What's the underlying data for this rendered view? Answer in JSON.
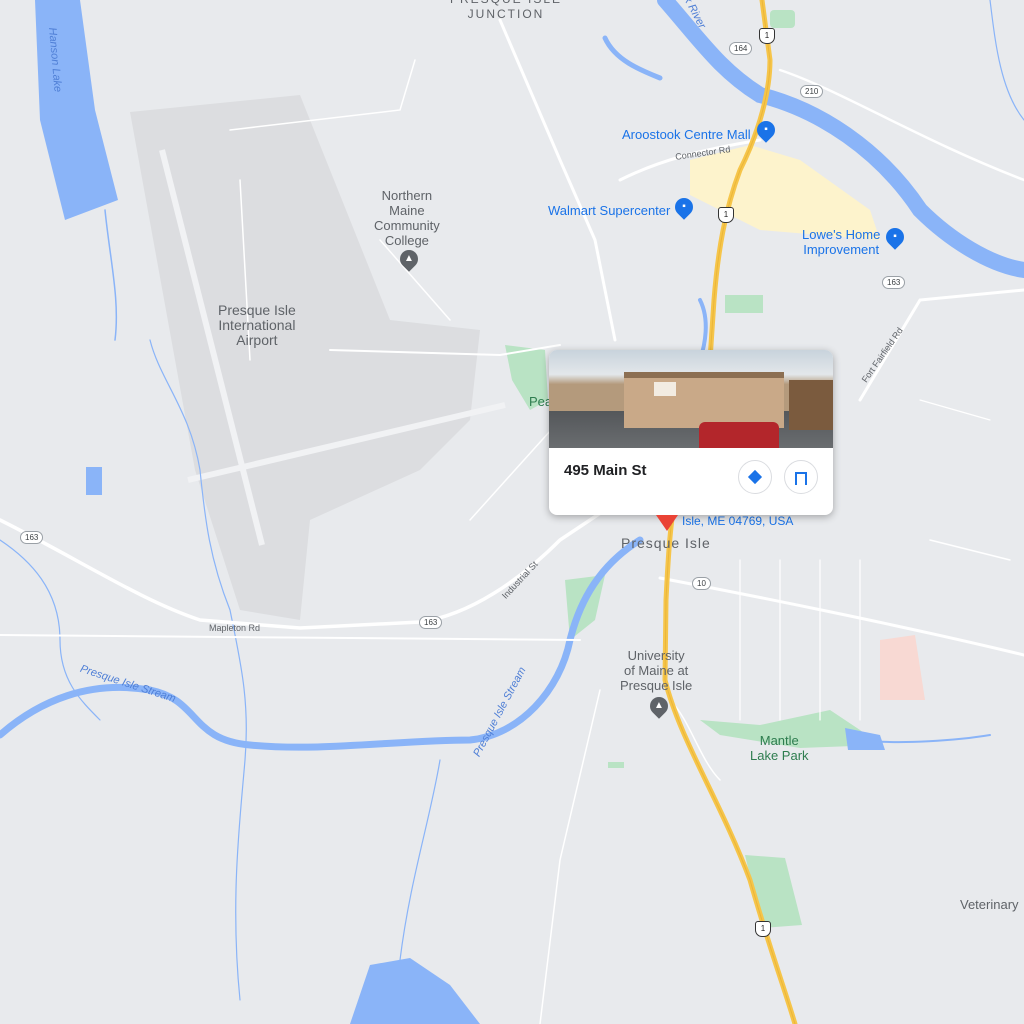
{
  "colors": {
    "water": "#8ab4f8",
    "road": "#ffffff",
    "highway": "#f6c54a",
    "park": "#b9e3c4",
    "commercial": "#fdf3cc",
    "airport": "#dcdde0",
    "poi": "#1a73e8",
    "marker": "#ea4335"
  },
  "places": {
    "junction": "PRESQUE ISLE\nJUNCTION",
    "airport": "Presque Isle\nInternational\nAirport",
    "college": "Northern\nMaine\nCommunity\nCollege",
    "town": "Presque Isle",
    "university": "University\nof Maine at\nPresque Isle",
    "veterinary": "Veterinary"
  },
  "pois": {
    "mall": "Aroostook Centre Mall",
    "walmart": "Walmart Supercenter",
    "lowes": "Lowe's Home\nImprovement",
    "park": "Mantle\nLake Park",
    "pea_partial": "Pea"
  },
  "water": {
    "hanson_lake": "Hanson Lake",
    "stream_w": "Presque Isle Stream",
    "stream_e": "Presque Isle Stream",
    "river": "ok River"
  },
  "roads": {
    "connector": "Connector Rd",
    "mapleton": "Mapleton Rd",
    "industrial": "Industrial St",
    "fort_fairfield": "Fort Fairfield Rd"
  },
  "shields": {
    "r164": "164",
    "r210": "210",
    "r163a": "163",
    "r163b": "163",
    "r163c": "163",
    "r10": "10",
    "us1a": "1",
    "us1b": "1",
    "us1c": "1"
  },
  "card": {
    "title": "495 Main St",
    "address_partial": "Isle, ME 04769, USA",
    "directions_icon": "directions-icon",
    "save_icon": "bookmark-icon"
  }
}
